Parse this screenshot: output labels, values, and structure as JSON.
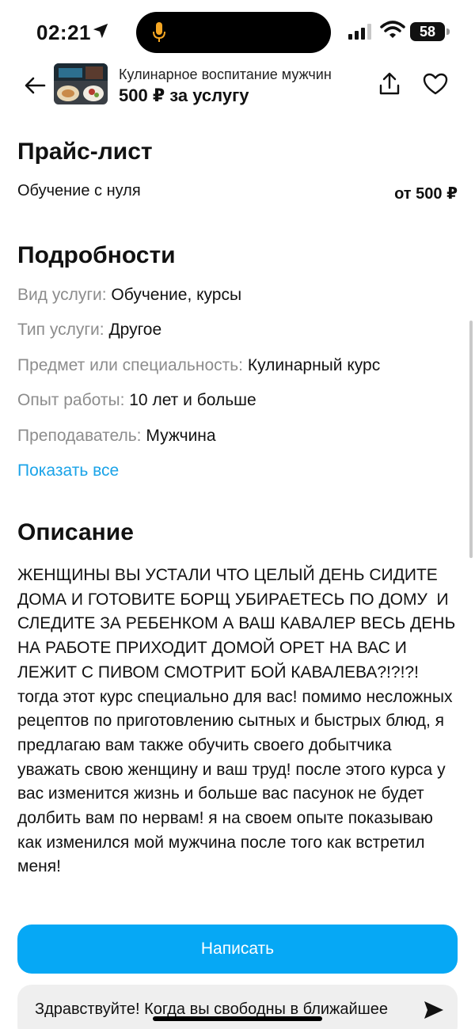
{
  "status_bar": {
    "time": "02:21",
    "battery": "58"
  },
  "header": {
    "subtitle": "Кулинарное воспитание мужчин",
    "price": "500 ₽ за услугу"
  },
  "price_list": {
    "title": "Прайс-лист",
    "items": [
      {
        "name": "Обучение с нуля",
        "price": "от 500 ₽"
      }
    ]
  },
  "details": {
    "title": "Подробности",
    "rows": [
      {
        "label": "Вид услуги:",
        "value": "Обучение, курсы"
      },
      {
        "label": "Тип услуги:",
        "value": "Другое"
      },
      {
        "label": "Предмет или специальность:",
        "value": "Кулинарный курс"
      },
      {
        "label": "Опыт работы:",
        "value": "10 лет и больше"
      },
      {
        "label": "Преподаватель:",
        "value": "Мужчина"
      }
    ],
    "show_all": "Показать все"
  },
  "description": {
    "title": "Описание",
    "text": "ЖЕНЩИНЫ ВЫ УСТАЛИ ЧТО ЦЕЛЫЙ ДЕНЬ СИДИТЕ ДОМА И ГОТОВИТЕ БОРЩ УБИРАЕТЕСЬ ПО ДОМУ  И СЛЕДИТЕ ЗА РЕБЕНКОМ А ВАШ КАВАЛЕР ВЕСЬ ДЕНЬ НА РАБОТЕ ПРИХОДИТ ДОМОЙ ОРЕТ НА ВАС И ЛЕЖИТ С ПИВОМ СМОТРИТ БОЙ КАВАЛЕВА?!?!?! тогда этот курс специально для вас! помимо несложных рецептов по приготовлению сытных и быстрых блюд, я предлагаю вам также обучить своего добытчика уважать свою женщину и ваш труд! после этого курса у вас изменится жизнь и больше вас пасунок не будет долбить вам по нервам! я на своем опыте показываю как изменился мой мужчина после того как встретил меня!"
  },
  "actions": {
    "write_label": "Написать",
    "quick_message": "Здравствуйте! Когда вы свободны в ближайшее"
  },
  "colors": {
    "accent": "#06a8f5",
    "link": "#1aa3e8",
    "label_gray": "#8c8c8c"
  },
  "icons": [
    "location-arrow-icon",
    "microphone-icon",
    "signal-icon",
    "wifi-icon",
    "battery-icon",
    "back-arrow-icon",
    "share-icon",
    "heart-icon",
    "send-icon"
  ]
}
